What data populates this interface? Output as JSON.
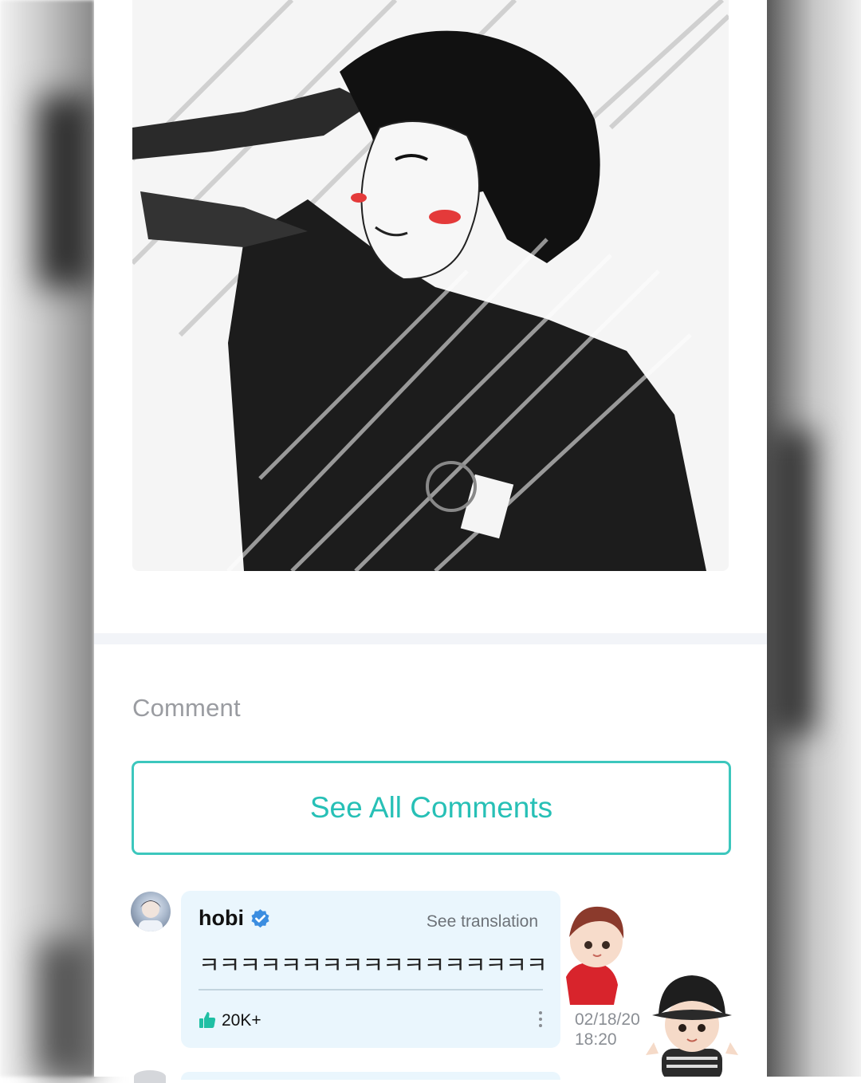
{
  "section": {
    "comment_heading": "Comment",
    "see_all_label": "See All Comments"
  },
  "comment": {
    "author": "hobi",
    "author_verified": true,
    "see_translation_label": "See translation",
    "text": "ㅋㅋㅋㅋㅋㅋㅋㅋㅋㅋㅋㅋㅋㅋㅋㅋㅋ",
    "likes": "20K+",
    "date_line1": "02/18/20",
    "date_line2": "18:20"
  },
  "icons": {
    "like": "thumbs-up-icon",
    "verified": "verified-badge-icon",
    "more": "more-vertical-icon"
  },
  "colors": {
    "accent": "#27c0b6",
    "bubble_bg": "#eaf6fd",
    "verified_blue": "#3b8de0",
    "like_green": "#1fbfa4",
    "muted_text": "#9a9ca1"
  }
}
